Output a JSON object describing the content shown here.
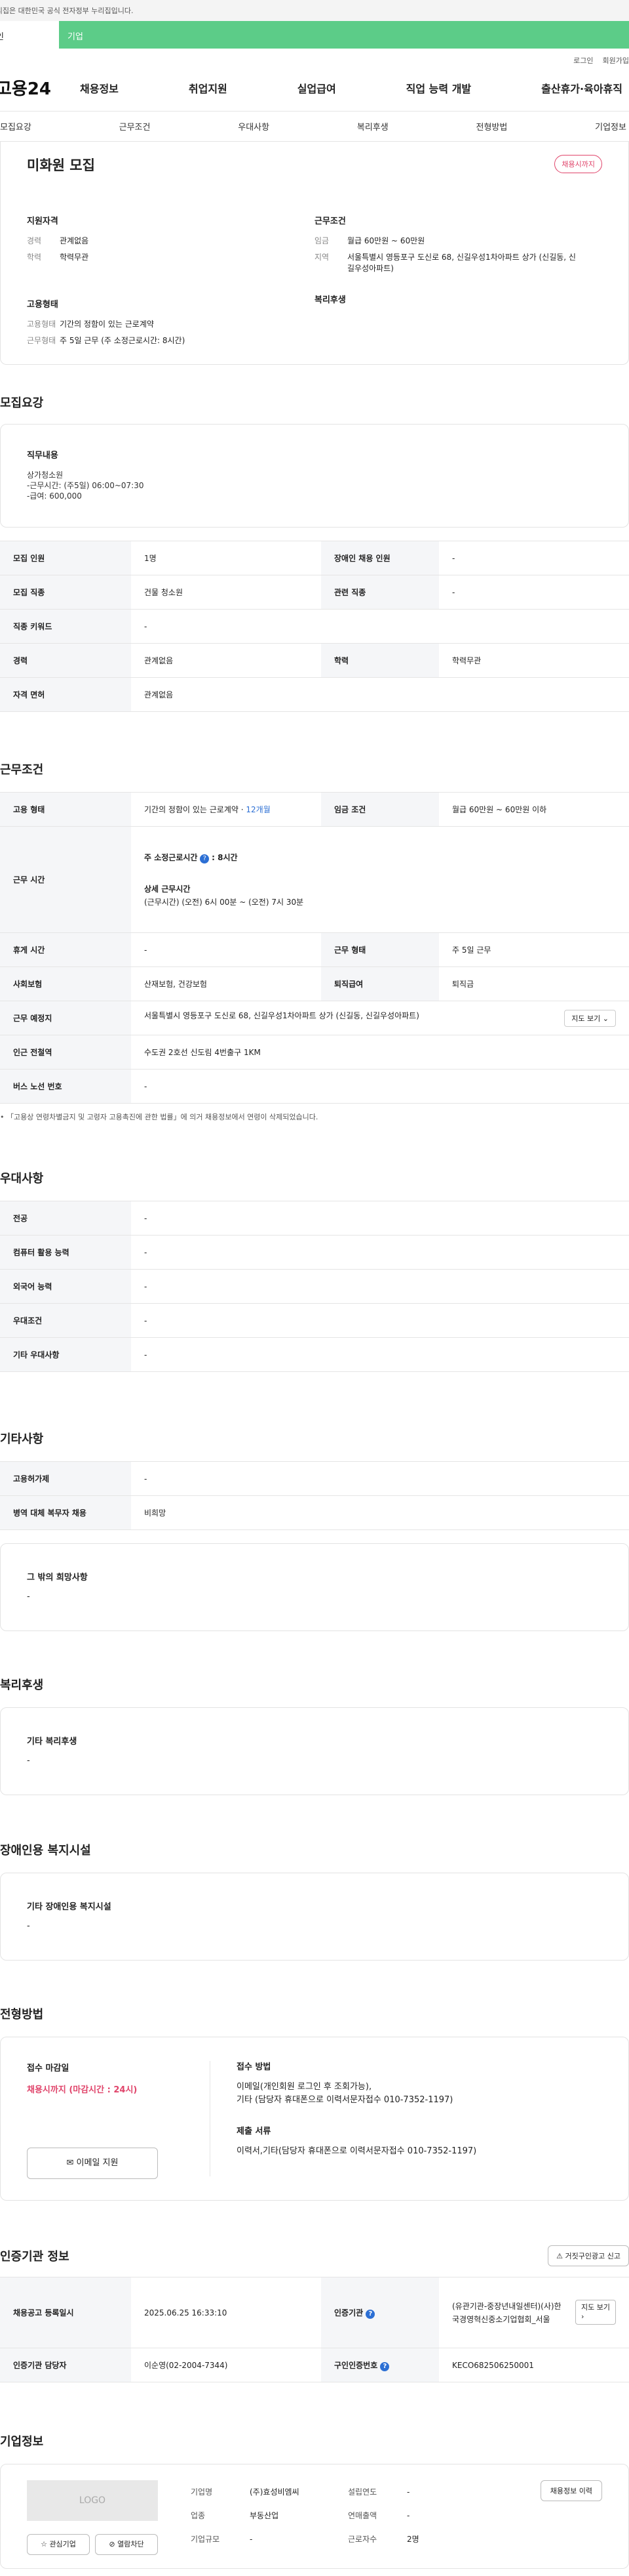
{
  "gov_banner": "이 누리집은 대한민국 공식 전자정부 누리집입니다.",
  "tabs": {
    "individual": "개인",
    "corporate": "기업"
  },
  "util_links": [
    "로그인",
    "회원가입"
  ],
  "logo": "고용24",
  "gnb": [
    "채용정보",
    "취업지원",
    "실업급여",
    "직업 능력 개발",
    "출산휴가·육아휴직"
  ],
  "subnav": [
    "모집요강",
    "근무조건",
    "우대사항",
    "복리후생",
    "전형방법",
    "기업정보"
  ],
  "header": {
    "title": "미화원 모집",
    "badge": "채용시까지"
  },
  "summary": {
    "qual_title": "지원자격",
    "career_k": "경력",
    "career_v": "관계없음",
    "edu_k": "학력",
    "edu_v": "학력무관",
    "work_title": "근무조건",
    "wage_k": "임금",
    "wage_v": "월급 60만원 ~ 60만원",
    "area_k": "지역",
    "area_v": "서울특별시 영등포구 도신로 68, 신길우성1차아파트 상가 (신길동, 신길우성아파트)",
    "emp_title": "고용형태",
    "emp_k": "고용형태",
    "emp_v": "기간의 정함이 있는 근로계약",
    "form_k": "근무형태",
    "form_v": "주 5일 근무 (주 소정근로시간: 8시간)",
    "welfare_title": "복리후생"
  },
  "recruit": {
    "title": "모집요강",
    "duty_label": "직무내용",
    "duty_text": [
      "상가청소원",
      "-근무시간: (주5일) 06:00~07:30",
      "-급여: 600,000"
    ],
    "rows": [
      {
        "k1": "모집 인원",
        "v1": "1명",
        "k2": "장애인 채용 인원",
        "v2": "-"
      },
      {
        "k1": "모집 직종",
        "v1": "건물 청소원",
        "k2": "관련 직종",
        "v2": "-"
      },
      {
        "k1": "직종 키워드",
        "v1": "-"
      },
      {
        "k1": "경력",
        "v1": "관계없음",
        "k2": "학력",
        "v2": "학력무관"
      },
      {
        "k1": "자격 면허",
        "v1": "관계없음"
      }
    ]
  },
  "conditions": {
    "title": "근무조건",
    "emp_k": "고용 형태",
    "emp_v": "기간의 정함이 있는 근로계약",
    "emp_months": "12개월",
    "wage_k": "임금 조건",
    "wage_v": "월급 60만원 ~ 60만원 이하",
    "hours_k": "근무 시간",
    "weekly_label": "주 소정근로시간",
    "weekly_val": ": 8시간",
    "detail_label": "상세 근무시간",
    "detail_val": "(근무시간) (오전) 6시 00분 ~ (오전) 7시 30분",
    "rest_k": "휴게 시간",
    "rest_v": "-",
    "form_k": "근무 형태",
    "form_v": "주 5일 근무",
    "ins_k": "사회보험",
    "ins_v": "산재보험, 건강보험",
    "sev_k": "퇴직급여",
    "sev_v": "퇴직금",
    "place_k": "근무 예정지",
    "place_v": "서울특별시 영등포구 도신로 68, 신길우성1차아파트 상가 (신길동, 신길우성아파트)",
    "map_btn": "지도 보기",
    "subway_k": "인근 전철역",
    "subway_v": "수도권 2호선 신도림 4번출구 1KM",
    "bus_k": "버스 노선 번호",
    "bus_v": "-",
    "note": "「고용상 연령차별금지 및 고령자 고용촉진에 관한 법률」에 의거 채용정보에서 연령이 삭제되었습니다."
  },
  "pref": {
    "title": "우대사항",
    "rows": [
      {
        "k": "전공",
        "v": "-"
      },
      {
        "k": "컴퓨터 활용 능력",
        "v": "-"
      },
      {
        "k": "외국어 능력",
        "v": "-"
      },
      {
        "k": "우대조건",
        "v": "-"
      },
      {
        "k": "기타 우대사항",
        "v": "-"
      }
    ]
  },
  "etc": {
    "title": "기타사항",
    "rows": [
      {
        "k": "고용허가제",
        "v": "-"
      },
      {
        "k": "병역 대체 복무자 채용",
        "v": "비희망"
      }
    ],
    "other_label": "그 밖의 희망사항",
    "other_val": "-"
  },
  "welfare": {
    "title": "복리후생",
    "label": "기타 복리후생",
    "val": "-"
  },
  "disabled": {
    "title": "장애인용 복지시설",
    "label": "기타 장애인용 복지시설",
    "val": "-"
  },
  "screening": {
    "title": "전형방법",
    "deadline_label": "접수 마감일",
    "deadline_val": "채용시까지 (마감시간 : 24시)",
    "apply_btn": "이메일 지원",
    "method_label": "접수 방법",
    "method_val": [
      "이메일(개인회원 로그인 후 조회가능),",
      "기타 (담당자 휴대폰으로 이력서문자접수 010-7352-1197)"
    ],
    "docs_label": "제출 서류",
    "docs_val": "이력서,기타(담당자 휴대폰으로 이력서문자접수 010-7352-1197)"
  },
  "cert": {
    "title": "인증기관 정보",
    "report_btn": "거짓구인광고 신고",
    "reg_k": "채용공고 등록일시",
    "reg_v": "2025.06.25 16:33:10",
    "org_k": "인증기관",
    "org_v": "(유관기관-중장년내일센터)(사)한국경영혁신중소기업협회_서울",
    "map_btn": "지도 보기",
    "mgr_k": "인증기관 담당자",
    "mgr_v": "이순영(02-2004-7344)",
    "num_k": "구인인증번호",
    "num_v": "KECO682506250001"
  },
  "company": {
    "title": "기업정보",
    "logo_text": "LOGO",
    "fav_btn": "관심기업",
    "block_btn": "열람차단",
    "name_k": "기업명",
    "name_v": "(주)효성비엠씨",
    "year_k": "설립연도",
    "year_v": "-",
    "ind_k": "업종",
    "ind_v": "부동산업",
    "sales_k": "연매출액",
    "sales_v": "-",
    "size_k": "기업규모",
    "size_v": "-",
    "emp_k": "근로자수",
    "emp_v": "2명",
    "jobs_btn": "채용정보 이력"
  }
}
